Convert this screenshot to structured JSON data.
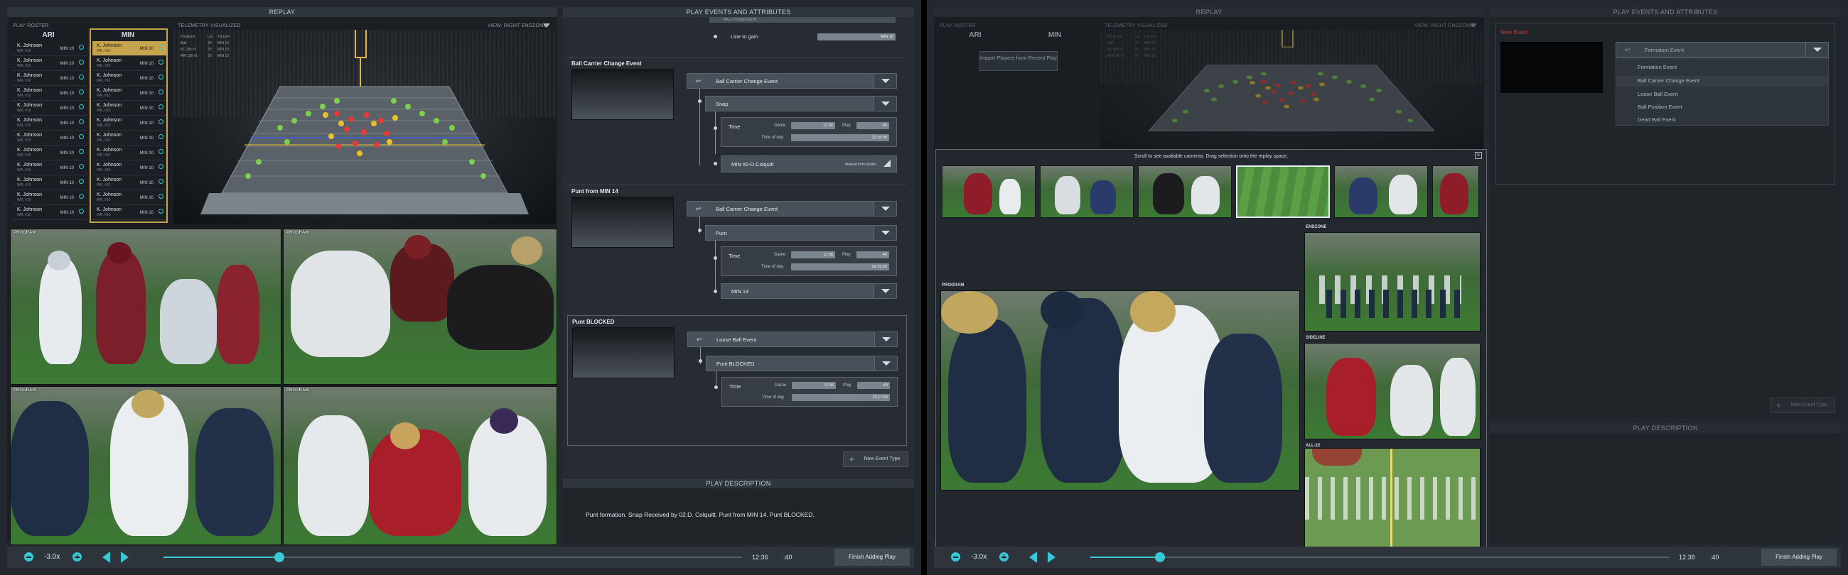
{
  "screen1": {
    "replay_title": "REPLAY",
    "roster": {
      "label": "PLAY ROSTER",
      "teams": [
        "ARI",
        "MIN"
      ],
      "ari": [
        {
          "name": "K. Johnson",
          "sub": "WR, #10"
        },
        {
          "name": "K. Johnson",
          "sub": "WR, #10"
        },
        {
          "name": "K. Johnson",
          "sub": "WR, #10"
        },
        {
          "name": "K. Johnson",
          "sub": "WR, #10"
        },
        {
          "name": "K. Johnson",
          "sub": "WR, #10"
        },
        {
          "name": "K. Johnson",
          "sub": "WR, #10"
        },
        {
          "name": "K. Johnson",
          "sub": "WR, #10"
        },
        {
          "name": "K. Johnson",
          "sub": "WR, #10"
        },
        {
          "name": "K. Johnson",
          "sub": "WR, #10"
        },
        {
          "name": "K. Johnson",
          "sub": "WR, #10"
        },
        {
          "name": "K. Johnson",
          "sub": "WR, #10"
        },
        {
          "name": "K. Johnson",
          "sub": "WR, #10"
        }
      ],
      "ari_team": "MIN 10",
      "min": [
        {
          "name": "K. Johnson",
          "sub": "WR, #10"
        },
        {
          "name": "K. Johnson",
          "sub": "WR, #10"
        },
        {
          "name": "K. Johnson",
          "sub": "WR, #10"
        },
        {
          "name": "K. Johnson",
          "sub": "WR, #10"
        },
        {
          "name": "K. Johnson",
          "sub": "WR, #10"
        },
        {
          "name": "K. Johnson",
          "sub": "WR, #10"
        },
        {
          "name": "K. Johnson",
          "sub": "WR, #10"
        },
        {
          "name": "K. Johnson",
          "sub": "WR, #10"
        },
        {
          "name": "K. Johnson",
          "sub": "WR, #10"
        },
        {
          "name": "K. Johnson",
          "sub": "WR, #10"
        },
        {
          "name": "K. Johnson",
          "sub": "WR, #10"
        },
        {
          "name": "K. Johnson",
          "sub": "WR, #10"
        }
      ],
      "min_team": "MIN 10"
    },
    "telemetry": {
      "label": "TELEMETRY VISUALIZED",
      "view": "VIEW: RIGHT ENDZONE",
      "legend_head": [
        "Positions",
        "Lat",
        "Yd Line"
      ],
      "legend_rows": [
        [
          "Ball",
          "20",
          "MIN 10"
        ],
        [
          "KC QB #1",
          "20",
          "MIN 10"
        ],
        [
          "ARI QB #1",
          "20",
          "MIN 10"
        ]
      ]
    },
    "videos": [
      {
        "label": "PROGRAM"
      },
      {
        "label": "PROGRAM"
      },
      {
        "label": "PROGRAM"
      },
      {
        "label": "PROGRAM"
      }
    ],
    "events": {
      "header": "PLAY EVENTS AND ATTRIBUTES",
      "top_partial": "BALL POSSESSION",
      "line_to_gain": "Line to gain",
      "line_to_gain_val": "MIN 10",
      "sections": [
        {
          "title": "Ball Carrier Change Event",
          "event": "Ball Carrier Change Event",
          "type": "Snap",
          "game": "12:36",
          "play": ":40",
          "tod": "22:16:09",
          "extra": "MIN #2-D.Colquitt",
          "extra_right": "Marked from Roster"
        },
        {
          "title": "Punt from MIN 14",
          "event": "Ball Carrier Change Event",
          "type": "Punt",
          "game": "12:36",
          "play": ":40",
          "tod": "22:16:09",
          "extra": "MIN 14"
        },
        {
          "title": "Punt BLOCKED",
          "event": "Loose Ball Event",
          "type": "Punt BLOCKED",
          "game": "12:36",
          "play": ":40",
          "tod": "22:17:56"
        }
      ],
      "time_label": "Time",
      "game_label": "Game",
      "play_label": "Play",
      "tod_label": "Time of day",
      "new_event_type": "New Event Type"
    },
    "description": {
      "header": "PLAY DESCRIPTION",
      "text": "Punt formation. Snap Received by 02.D. Colquitt. Punt from MIN 14. Punt BLOCKED."
    },
    "transport": {
      "speed": "-3.0x",
      "time": "12:36",
      "play": ":40",
      "progress": 0.2,
      "finish": "Finish Adding Play"
    }
  },
  "screen2": {
    "replay_title": "REPLAY",
    "roster_label": "PLAY ROSTER",
    "teams": [
      "ARI",
      "MIN"
    ],
    "import_btn": "Import Players from Recent Play",
    "telemetry_label": "TELEMETRY VISUALIZED",
    "view": "VIEW: RIGHT ENDZONE",
    "legend_head": [
      "Positions",
      "Lat",
      "Yd Line"
    ],
    "legend_rows": [
      [
        "Ball",
        "20",
        "MIN 10"
      ],
      [
        "KC QB #1",
        "20",
        "MIN 10"
      ],
      [
        "ARI QB #1",
        "20",
        "MIN 10"
      ]
    ],
    "events_header": "PLAY EVENTS AND ATTRIBUTES",
    "new_event_label": "New Event",
    "dropdown_value": "Formation Event",
    "dropdown_options": [
      "Formation Event",
      "Ball Carrier Change Event",
      "Loose Ball Event",
      "Ball Position Event",
      "Dead Ball Event"
    ],
    "new_event_type": "New Event Type",
    "description_header": "PLAY DESCRIPTION",
    "overlay": {
      "hint": "Scroll to see available cameras. Drag selection onto the replay space.",
      "close": "×",
      "program_label": "PROGRAM",
      "side_labels": [
        "ENDZONE",
        "SIDELINE",
        "ALL-22"
      ]
    },
    "transport": {
      "speed": "-3.0x",
      "time": "12:38",
      "play": ":40",
      "progress": 0.12,
      "finish": "Finish Adding Play"
    }
  },
  "colors": {
    "accent": "#38c9d6",
    "highlight": "#c6a34d",
    "alert": "#d83a3a"
  }
}
